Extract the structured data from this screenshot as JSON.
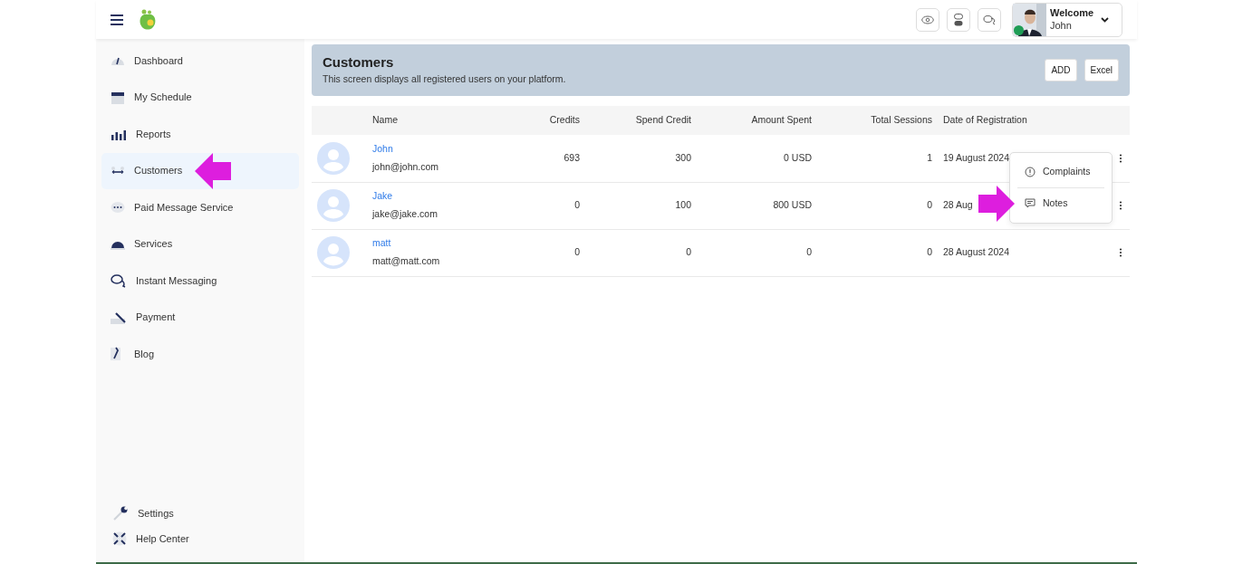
{
  "header": {
    "user": {
      "greeting": "Welcome",
      "name": "John",
      "online": true
    }
  },
  "sidebar": {
    "items": [
      {
        "label": "Dashboard",
        "selected": false
      },
      {
        "label": "My Schedule",
        "selected": false
      },
      {
        "label": "Reports",
        "selected": false
      },
      {
        "label": "Customers",
        "selected": true
      },
      {
        "label": "Paid Message Service",
        "selected": false
      },
      {
        "label": "Services",
        "selected": false
      },
      {
        "label": "Instant Messaging",
        "selected": false
      },
      {
        "label": "Payment",
        "selected": false
      },
      {
        "label": "Blog",
        "selected": false
      }
    ],
    "footer_items": [
      {
        "label": "Settings"
      },
      {
        "label": "Help Center"
      }
    ]
  },
  "page": {
    "title": "Customers",
    "subtitle": "This screen displays all registered users on your platform.",
    "buttons": [
      "ADD",
      "Excel"
    ]
  },
  "table": {
    "columns": [
      "Name",
      "Credits",
      "Spend Credit",
      "Amount Spent",
      "Total Sessions",
      "Date of Registration"
    ],
    "rows": [
      {
        "name": "John",
        "email": "john@john.com",
        "credits": "693",
        "spend_credit": "300",
        "amount_spent": "0 USD",
        "total_sessions": "1",
        "date": "19 August 2024"
      },
      {
        "name": "Jake",
        "email": "jake@jake.com",
        "credits": "0",
        "spend_credit": "100",
        "amount_spent": "800 USD",
        "total_sessions": "0",
        "date": "28 Aug"
      },
      {
        "name": "matt",
        "email": "matt@matt.com",
        "credits": "0",
        "spend_credit": "0",
        "amount_spent": "0",
        "total_sessions": "0",
        "date": "28 August 2024"
      }
    ]
  },
  "row_menu": {
    "open": true,
    "items": [
      {
        "label": "Complaints"
      },
      {
        "label": "Notes"
      }
    ]
  }
}
